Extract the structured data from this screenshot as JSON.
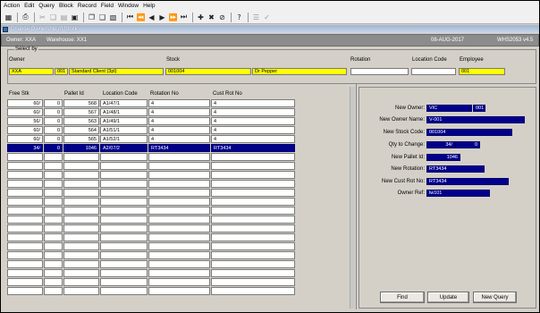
{
  "menu": [
    "Action",
    "Edit",
    "Query",
    "Block",
    "Record",
    "Field",
    "Window",
    "Help"
  ],
  "window_title": "Change Ownership of Stock",
  "status": {
    "owner": "Owner: XXA",
    "warehouse": "Warehouse: XX1",
    "date": "08-AUG-2017",
    "version": "WHS2053  v4.5"
  },
  "select_by": {
    "legend": "Select by",
    "owner_label": "Owner",
    "stock_label": "Stock",
    "rotation_label": "Rotation",
    "location_code_label": "Location Code",
    "employee_label": "Employee",
    "owner_code": "XXA",
    "owner_num": "001",
    "owner_name": "Standard Client (3pl)",
    "stock_code": "001004",
    "stock_desc": "Dr Pepper",
    "rotation": "",
    "location_code": "",
    "employee": "001"
  },
  "columns": [
    "Free Stk",
    "Pallet Id",
    "Location Code",
    "Rotation No",
    "Cust Rot No"
  ],
  "rows": [
    {
      "qty": "60/",
      "qty2": "0",
      "pallet": "568",
      "loc": "A1/47/1",
      "rot": "4",
      "cust": "4"
    },
    {
      "qty": "60/",
      "qty2": "0",
      "pallet": "567",
      "loc": "A1/48/1",
      "rot": "4",
      "cust": "4"
    },
    {
      "qty": "56/",
      "qty2": "0",
      "pallet": "563",
      "loc": "A1/49/1",
      "rot": "4",
      "cust": "4"
    },
    {
      "qty": "60/",
      "qty2": "0",
      "pallet": "564",
      "loc": "A1/51/1",
      "rot": "4",
      "cust": "4"
    },
    {
      "qty": "60/",
      "qty2": "0",
      "pallet": "565",
      "loc": "A1/52/1",
      "rot": "4",
      "cust": "4"
    },
    {
      "qty": "34/",
      "qty2": "0",
      "pallet": "1046",
      "loc": "A2/07/2",
      "rot": "RT3434",
      "cust": "RT3434"
    }
  ],
  "right_panel": {
    "new_owner_label": "New Owner:",
    "new_owner": "VIC",
    "new_owner_num": "001",
    "new_owner_name_label": "New Owner Name:",
    "new_owner_name": "V-001",
    "new_stock_code_label": "New Stock Code:",
    "new_stock_code": "001004",
    "qty_label": "Qty to Change:",
    "qty": "34/",
    "qty2": "0",
    "new_pallet_label": "New Pallet Id:",
    "new_pallet": "1046",
    "new_rotation_label": "New Rotation:",
    "new_rotation": "RT3434",
    "new_cust_rot_label": "New Cust Rot No:",
    "new_cust_rot": "RT3434",
    "owner_ref_label": "Owner Ref:",
    "owner_ref": "lw101"
  },
  "buttons": {
    "find": "Find",
    "update": "Update",
    "new_query": "New Query"
  },
  "toolbar_icons": [
    "save-icon",
    "print-icon",
    "cut-icon",
    "copy-icon",
    "paste-icon",
    "delete-icon",
    "copy-record-icon",
    "paste-record-icon",
    "clear-icon",
    "first-icon",
    "prev-block-icon",
    "prev-icon",
    "next-icon",
    "next-block-icon",
    "last-icon",
    "insert-icon",
    "remove-icon",
    "clear-record-icon",
    "help-icon",
    "list-icon",
    "accept-icon"
  ],
  "colors": {
    "selected": "#00008b",
    "query_field": "#ffff00",
    "status_bar": "#8c8c8c"
  }
}
